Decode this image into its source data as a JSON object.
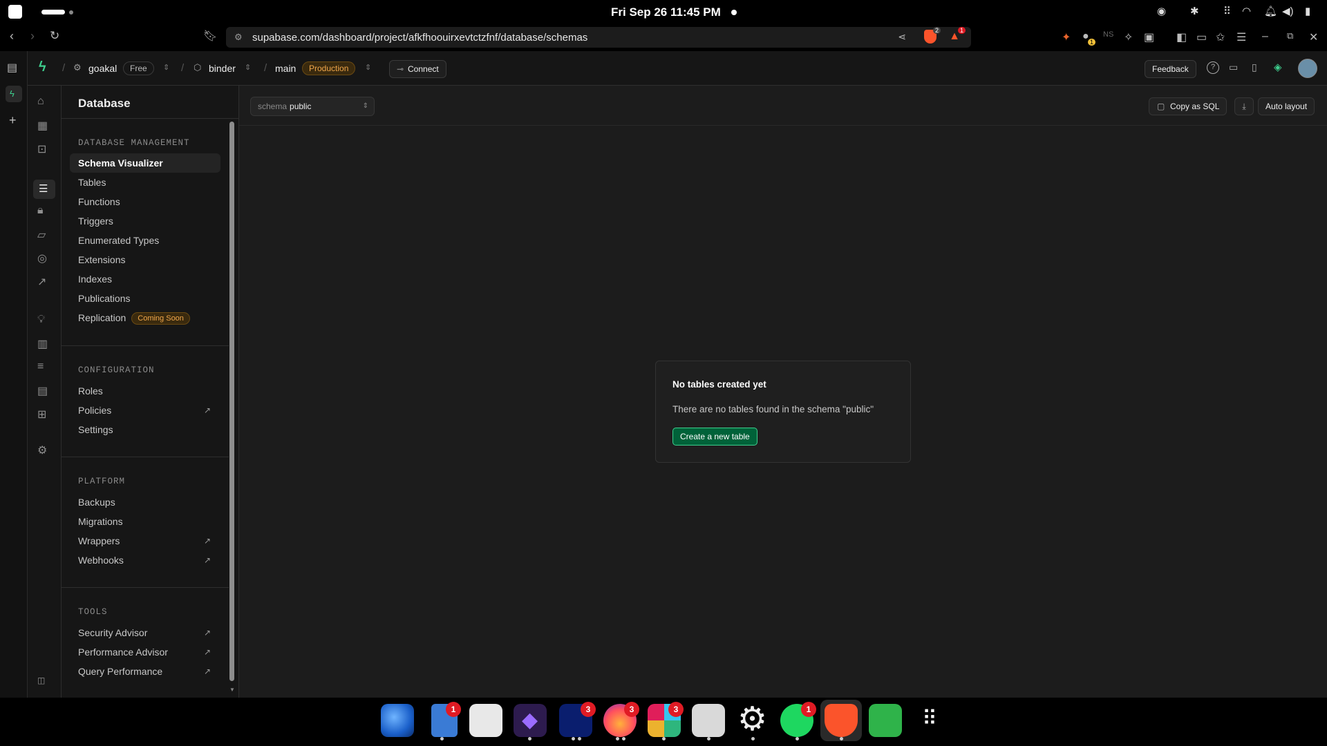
{
  "os": {
    "clock": "Fri Sep 26  11:45 PM"
  },
  "browser": {
    "url": "supabase.com/dashboard/project/afkfhoouirxevtctzfnf/database/schemas",
    "brave_badge": "2",
    "alert_badge": "1",
    "ext_badge": "1"
  },
  "topnav": {
    "org": "goakal",
    "plan": "Free",
    "project": "binder",
    "branch": "main",
    "env": "Production",
    "connect": "Connect",
    "feedback": "Feedback"
  },
  "menu": {
    "title": "Database",
    "sections": [
      {
        "heading": "DATABASE MANAGEMENT",
        "items": [
          "Schema Visualizer",
          "Tables",
          "Functions",
          "Triggers",
          "Enumerated Types",
          "Extensions",
          "Indexes",
          "Publications",
          "Replication"
        ]
      },
      {
        "heading": "CONFIGURATION",
        "items": [
          "Roles",
          "Policies",
          "Settings"
        ]
      },
      {
        "heading": "PLATFORM",
        "items": [
          "Backups",
          "Migrations",
          "Wrappers",
          "Webhooks"
        ]
      },
      {
        "heading": "TOOLS",
        "items": [
          "Security Advisor",
          "Performance Advisor",
          "Query Performance"
        ]
      }
    ],
    "coming_soon": "Coming Soon",
    "active": "Schema Visualizer"
  },
  "toolbar": {
    "schema_label": "schema",
    "schema_value": "public",
    "copy_sql": "Copy as SQL",
    "auto_layout": "Auto layout"
  },
  "empty": {
    "title": "No tables created yet",
    "description": "There are no tables found in the schema \"public\"",
    "button": "Create a new table"
  },
  "dock": {
    "badges": [
      "1",
      "3",
      "3",
      "3",
      "1"
    ]
  }
}
